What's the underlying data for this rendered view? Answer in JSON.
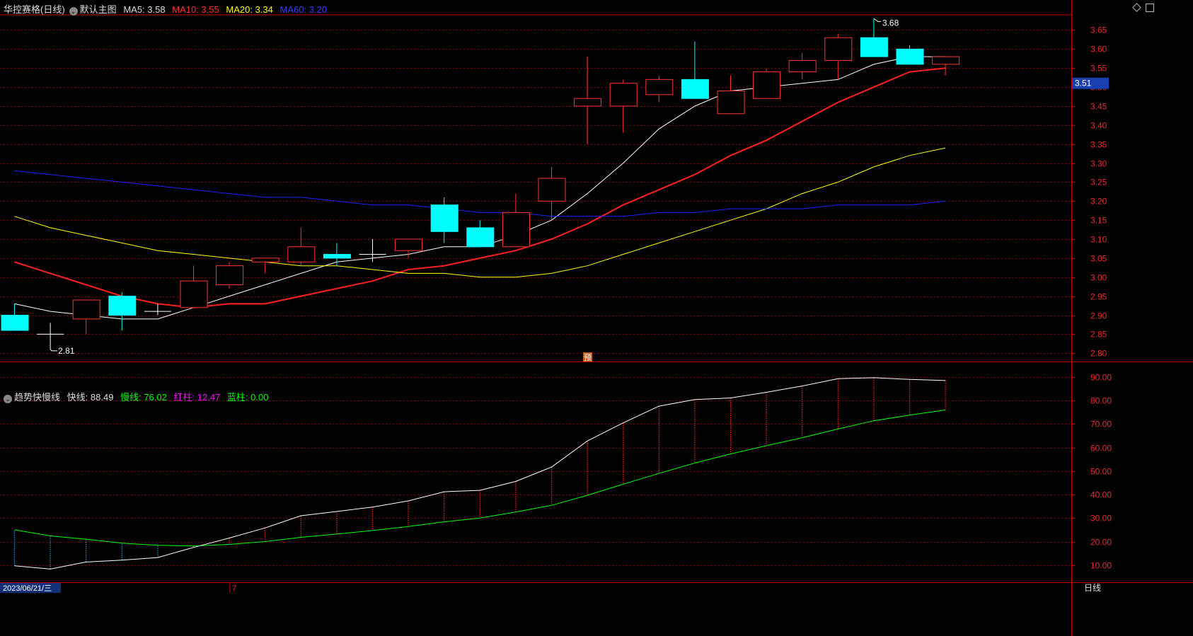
{
  "header": {
    "stock_name": "华控赛格(日线)",
    "template_name": "默认主图",
    "ma5_label": "MA5:",
    "ma5_value": "3.58",
    "ma10_label": "MA10:",
    "ma10_value": "3.55",
    "ma20_label": "MA20:",
    "ma20_value": "3.34",
    "ma60_label": "MA60:",
    "ma60_value": "3.20"
  },
  "indicator_header": {
    "name": "趋势快慢线",
    "fast_label": "快线:",
    "fast_value": "88.49",
    "slow_label": "慢线:",
    "slow_value": "76.02",
    "red_label": "红柱:",
    "red_value": "12.47",
    "blue_label": "蓝柱:",
    "blue_value": "0.00"
  },
  "footer": {
    "date": "2023/06/21/三",
    "month_marker": "7",
    "period": "日线"
  },
  "price_tag": "3.51",
  "pre_marker": "预",
  "annotations": {
    "high": "3.68",
    "low": "2.81"
  },
  "colors": {
    "up": "#ff3232",
    "down": "#00ffff",
    "ma5": "#ffffff",
    "ma10": "#ff2020",
    "ma20": "#ffff00",
    "ma60": "#2020ff",
    "fast": "#ffffff",
    "slow": "#00ff00",
    "grid": "#800000",
    "axis": "#c80000"
  },
  "chart_data": [
    {
      "type": "candlestick",
      "title": "华控赛格(日线)",
      "ylim": [
        2.78,
        3.69
      ],
      "y_ticks": [
        "2.80",
        "2.85",
        "2.90",
        "2.95",
        "3.00",
        "3.05",
        "3.10",
        "3.15",
        "3.20",
        "3.25",
        "3.30",
        "3.35",
        "3.40",
        "3.45",
        "3.50",
        "3.55",
        "3.60",
        "3.65"
      ],
      "candles": [
        {
          "o": 2.9,
          "h": 2.93,
          "l": 2.86,
          "c": 2.86
        },
        {
          "o": 2.85,
          "h": 2.88,
          "l": 2.81,
          "c": 2.85
        },
        {
          "o": 2.89,
          "h": 2.94,
          "l": 2.85,
          "c": 2.94
        },
        {
          "o": 2.95,
          "h": 2.96,
          "l": 2.86,
          "c": 2.9
        },
        {
          "o": 2.91,
          "h": 2.93,
          "l": 2.9,
          "c": 2.91
        },
        {
          "o": 2.92,
          "h": 3.03,
          "l": 2.92,
          "c": 2.99
        },
        {
          "o": 2.98,
          "h": 3.04,
          "l": 2.97,
          "c": 3.03
        },
        {
          "o": 3.04,
          "h": 3.05,
          "l": 3.01,
          "c": 3.05
        },
        {
          "o": 3.04,
          "h": 3.13,
          "l": 3.03,
          "c": 3.08
        },
        {
          "o": 3.06,
          "h": 3.09,
          "l": 3.03,
          "c": 3.05
        },
        {
          "o": 3.06,
          "h": 3.1,
          "l": 3.04,
          "c": 3.06
        },
        {
          "o": 3.07,
          "h": 3.1,
          "l": 3.05,
          "c": 3.1
        },
        {
          "o": 3.19,
          "h": 3.21,
          "l": 3.09,
          "c": 3.12
        },
        {
          "o": 3.13,
          "h": 3.15,
          "l": 3.08,
          "c": 3.08
        },
        {
          "o": 3.08,
          "h": 3.22,
          "l": 3.08,
          "c": 3.17
        },
        {
          "o": 3.2,
          "h": 3.29,
          "l": 3.15,
          "c": 3.26
        },
        {
          "o": 3.45,
          "h": 3.58,
          "l": 3.35,
          "c": 3.47
        },
        {
          "o": 3.45,
          "h": 3.52,
          "l": 3.38,
          "c": 3.51
        },
        {
          "o": 3.48,
          "h": 3.53,
          "l": 3.46,
          "c": 3.52
        },
        {
          "o": 3.52,
          "h": 3.62,
          "l": 3.47,
          "c": 3.47
        },
        {
          "o": 3.43,
          "h": 3.53,
          "l": 3.43,
          "c": 3.49
        },
        {
          "o": 3.47,
          "h": 3.55,
          "l": 3.47,
          "c": 3.54
        },
        {
          "o": 3.54,
          "h": 3.59,
          "l": 3.52,
          "c": 3.57
        },
        {
          "o": 3.57,
          "h": 3.64,
          "l": 3.52,
          "c": 3.63
        },
        {
          "o": 3.63,
          "h": 3.68,
          "l": 3.58,
          "c": 3.58
        },
        {
          "o": 3.6,
          "h": 3.61,
          "l": 3.56,
          "c": 3.56
        },
        {
          "o": 3.56,
          "h": 3.58,
          "l": 3.53,
          "c": 3.58
        }
      ],
      "series": [
        {
          "name": "MA5",
          "values": [
            2.93,
            2.91,
            2.9,
            2.89,
            2.89,
            2.92,
            2.95,
            2.98,
            3.01,
            3.04,
            3.05,
            3.06,
            3.08,
            3.08,
            3.11,
            3.15,
            3.22,
            3.3,
            3.39,
            3.45,
            3.49,
            3.5,
            3.51,
            3.52,
            3.56,
            3.58,
            3.58
          ]
        },
        {
          "name": "MA10",
          "values": [
            3.04,
            3.01,
            2.98,
            2.95,
            2.93,
            2.92,
            2.93,
            2.93,
            2.95,
            2.97,
            2.99,
            3.02,
            3.03,
            3.05,
            3.07,
            3.1,
            3.14,
            3.19,
            3.23,
            3.27,
            3.32,
            3.36,
            3.41,
            3.46,
            3.5,
            3.54,
            3.55
          ]
        },
        {
          "name": "MA20",
          "values": [
            3.16,
            3.13,
            3.11,
            3.09,
            3.07,
            3.06,
            3.05,
            3.04,
            3.03,
            3.03,
            3.02,
            3.01,
            3.01,
            3.0,
            3.0,
            3.01,
            3.03,
            3.06,
            3.09,
            3.12,
            3.15,
            3.18,
            3.22,
            3.25,
            3.29,
            3.32,
            3.34
          ]
        },
        {
          "name": "MA60",
          "values": [
            3.28,
            3.27,
            3.26,
            3.25,
            3.24,
            3.23,
            3.22,
            3.21,
            3.21,
            3.2,
            3.19,
            3.19,
            3.18,
            3.17,
            3.17,
            3.16,
            3.16,
            3.16,
            3.17,
            3.17,
            3.18,
            3.18,
            3.18,
            3.19,
            3.19,
            3.19,
            3.2
          ]
        }
      ]
    },
    {
      "type": "line",
      "title": "趋势快慢线",
      "ylim": [
        3,
        96
      ],
      "y_ticks": [
        "10.00",
        "20.00",
        "30.00",
        "40.00",
        "50.00",
        "60.00",
        "70.00",
        "80.00",
        "90.00"
      ],
      "series": [
        {
          "name": "快线",
          "values": [
            9.7,
            8.3,
            11.3,
            12.1,
            13.2,
            17.5,
            21.5,
            25.8,
            31.0,
            32.8,
            34.7,
            37.3,
            41.2,
            41.8,
            45.6,
            51.7,
            62.8,
            70.5,
            77.6,
            80.4,
            81.1,
            83.5,
            86.2,
            89.3,
            89.7,
            89.0,
            88.5
          ]
        },
        {
          "name": "慢线",
          "values": [
            25.0,
            22.4,
            21.0,
            19.3,
            18.4,
            18.1,
            18.8,
            20.0,
            21.8,
            23.2,
            24.7,
            26.4,
            28.4,
            30.0,
            32.6,
            35.4,
            39.7,
            44.4,
            49.0,
            53.4,
            57.3,
            60.8,
            64.2,
            67.9,
            71.4,
            73.8,
            76.0
          ]
        }
      ]
    }
  ]
}
